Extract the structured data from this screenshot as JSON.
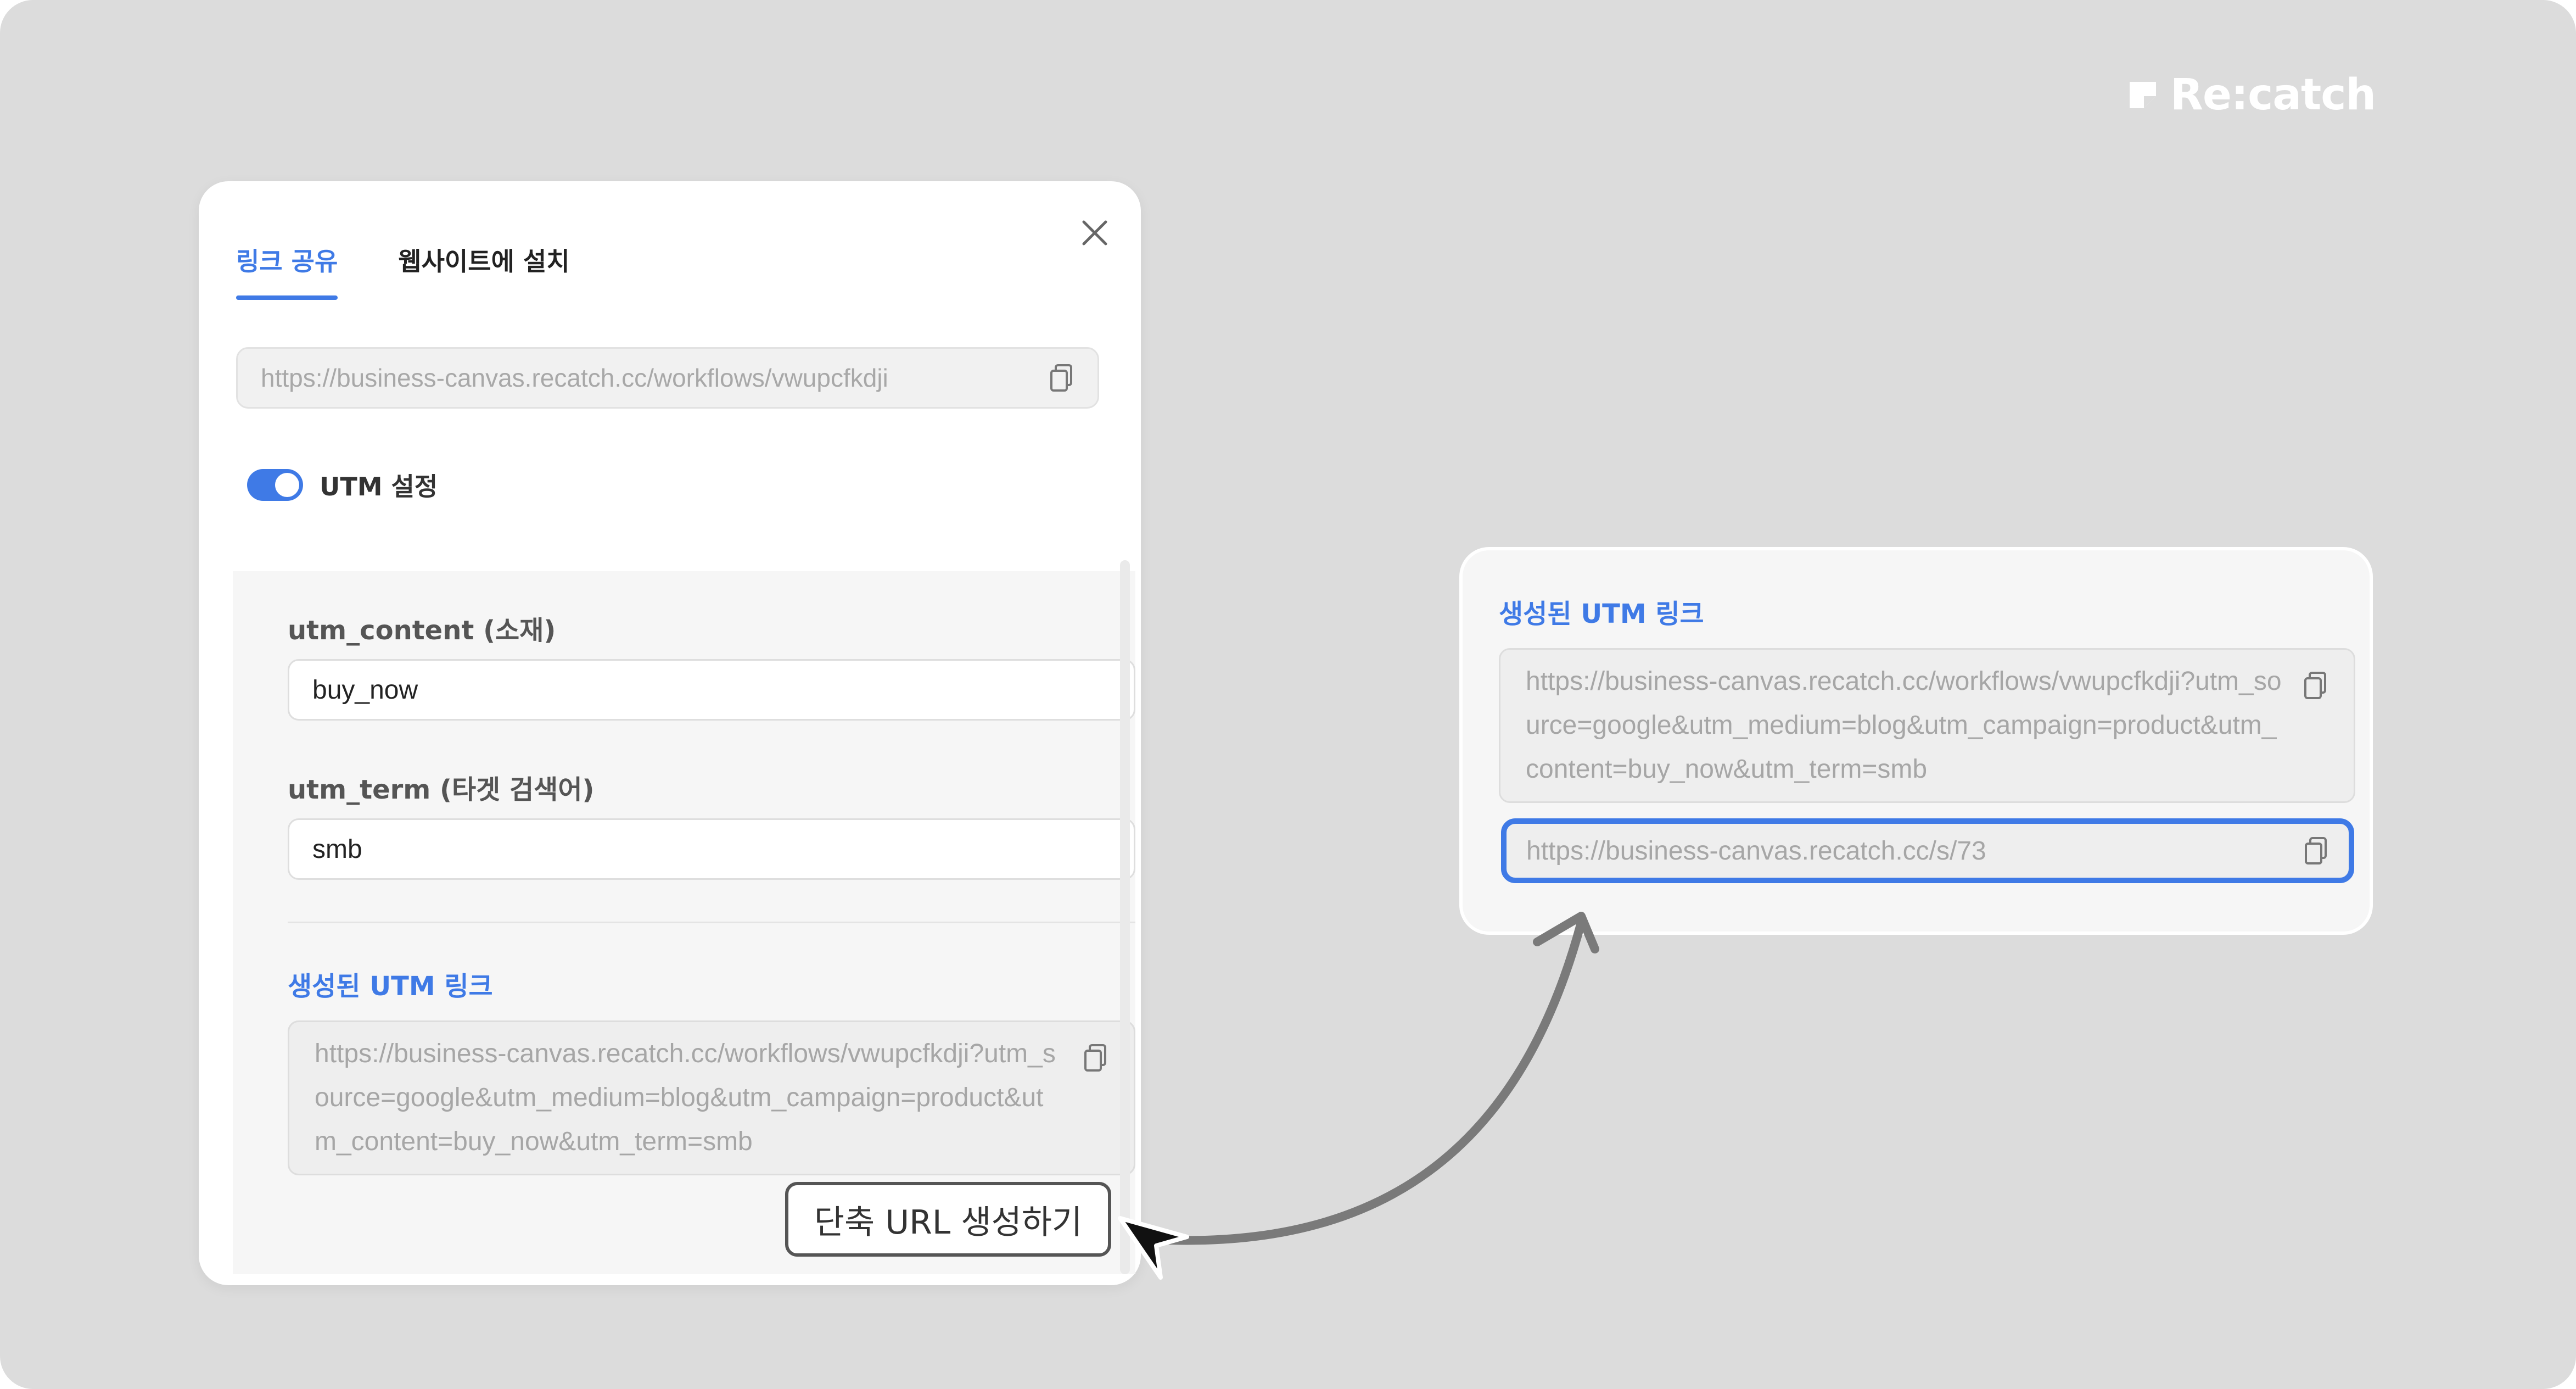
{
  "brand": {
    "name": "Re:catch"
  },
  "panel": {
    "tabs": [
      {
        "label": "링크 공유",
        "active": true
      },
      {
        "label": "웹사이트에 설치",
        "active": false
      }
    ],
    "base_url": "https://business-canvas.recatch.cc/workflows/vwupcfkdji",
    "utm_toggle": {
      "label": "UTM 설정",
      "enabled": true
    },
    "fields": [
      {
        "label": "utm_content (소재)",
        "value": "buy_now"
      },
      {
        "label": "utm_term (타겟 검색어)",
        "value": "smb"
      }
    ],
    "generated": {
      "label": "생성된 UTM 링크",
      "url": "https://business-canvas.recatch.cc/workflows/vwupcfkdji?utm_source=google&utm_medium=blog&utm_campaign=product&utm_content=buy_now&utm_term=smb"
    },
    "shorten_button": "단축 URL 생성하기"
  },
  "card": {
    "label": "생성된 UTM 링크",
    "url": "https://business-canvas.recatch.cc/workflows/vwupcfkdji?utm_source=google&utm_medium=blog&utm_campaign=product&utm_content=buy_now&utm_term=smb",
    "short_url": "https://business-canvas.recatch.cc/s/73"
  },
  "colors": {
    "accent": "#3f7ae6",
    "background": "#dcdcdc"
  },
  "icons": [
    "close-icon",
    "copy-icon",
    "cursor-arrow-icon",
    "curved-arrow-icon",
    "recatch-logo-icon"
  ]
}
